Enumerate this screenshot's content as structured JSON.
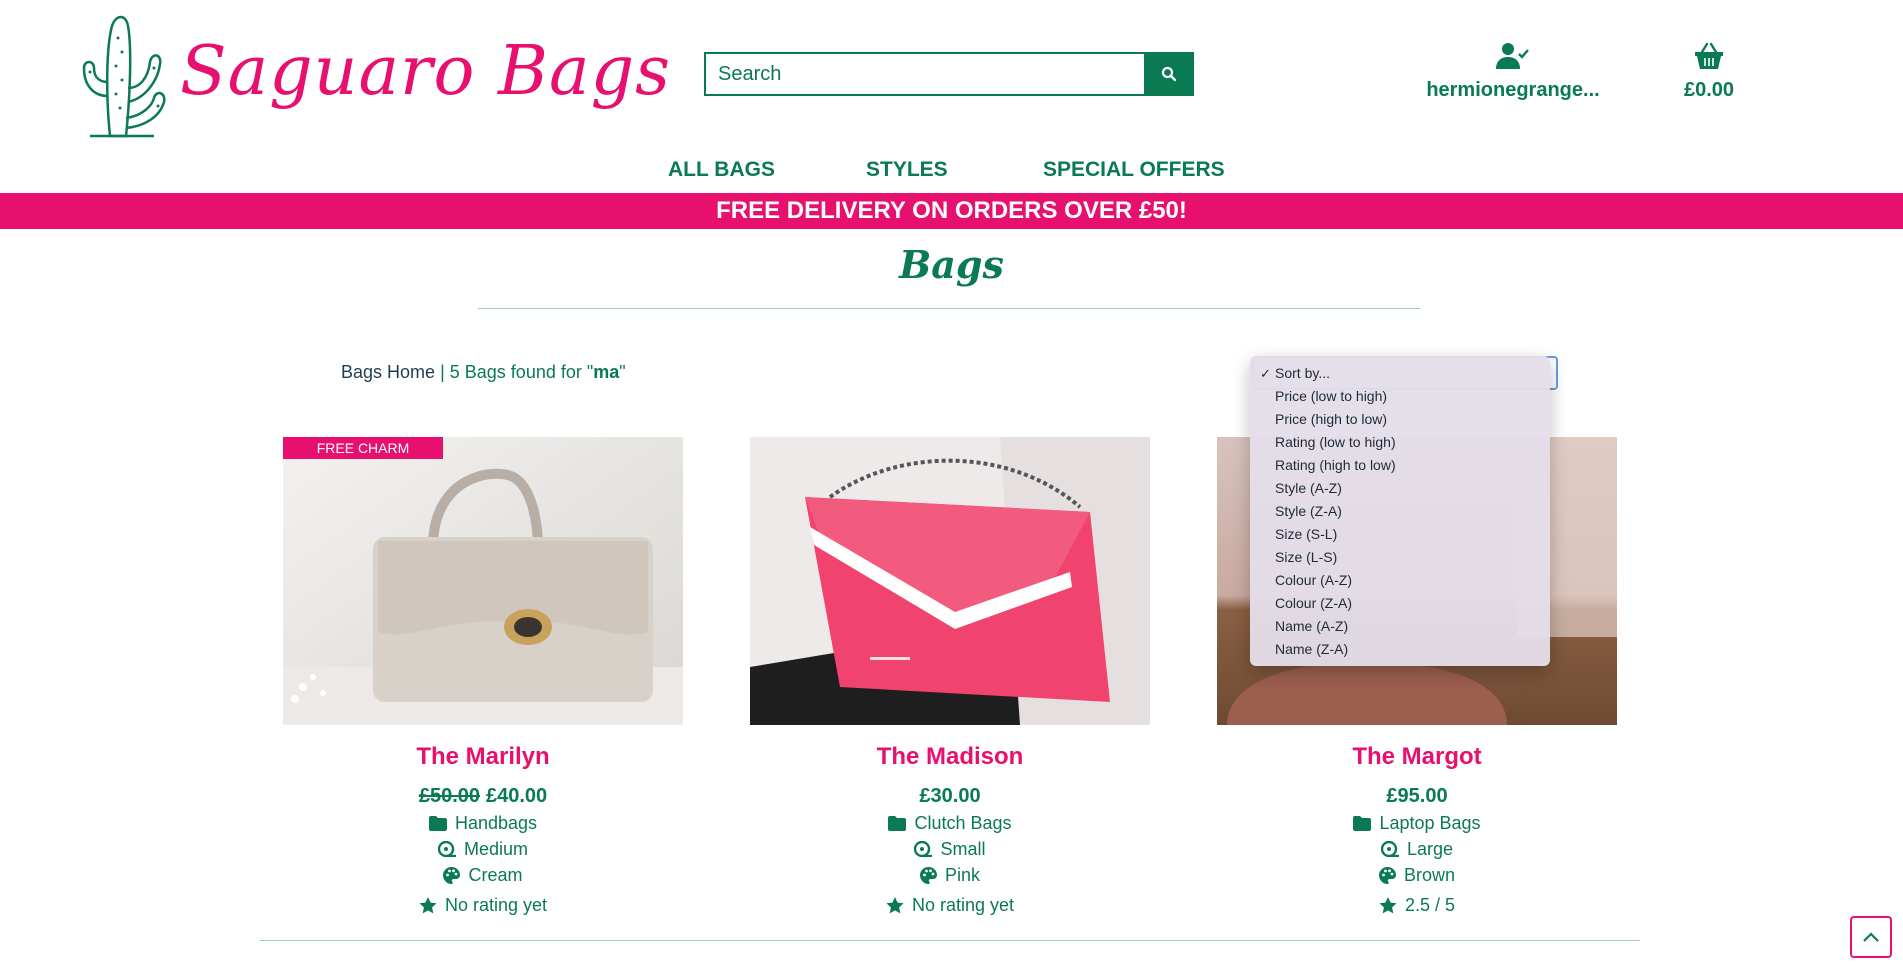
{
  "brand": {
    "name": "Saguaro Bags",
    "accent": "#e8106e",
    "primary": "#0a7a53"
  },
  "search": {
    "placeholder": "Search",
    "icon": "search-icon"
  },
  "account": {
    "username": "hermionegrange...",
    "icon": "user-check-icon"
  },
  "basket": {
    "total": "£0.00",
    "icon": "basket-icon"
  },
  "nav": {
    "items": [
      "ALL BAGS",
      "STYLES",
      "SPECIAL OFFERS"
    ]
  },
  "banner": {
    "text": "FREE DELIVERY ON ORDERS OVER £50!"
  },
  "page": {
    "title": "Bags"
  },
  "breadcrumb": {
    "home": "Bags Home",
    "separator": "|",
    "count_text": "5 Bags found for \"",
    "term": "ma",
    "close": "\""
  },
  "sort": {
    "selected": "Sort by...",
    "options": [
      "Sort by...",
      "Price (low to high)",
      "Price (high to low)",
      "Rating (low to high)",
      "Rating (high to low)",
      "Style (A-Z)",
      "Style (Z-A)",
      "Size (S-L)",
      "Size (L-S)",
      "Colour (A-Z)",
      "Colour (Z-A)",
      "Name (A-Z)",
      "Name (Z-A)"
    ]
  },
  "products": [
    {
      "badge": "FREE CHARM",
      "name": "The Marilyn",
      "old_price": "£50.00",
      "price": "£40.00",
      "style": "Handbags",
      "size": "Medium",
      "colour": "Cream",
      "rating": "No rating yet"
    },
    {
      "badge": "",
      "name": "The Madison",
      "old_price": "",
      "price": "£30.00",
      "style": "Clutch Bags",
      "size": "Small",
      "colour": "Pink",
      "rating": "No rating yet"
    },
    {
      "badge": "",
      "name": "The Margot",
      "old_price": "",
      "price": "£95.00",
      "style": "Laptop Bags",
      "size": "Large",
      "colour": "Brown",
      "rating": "2.5 / 5"
    }
  ]
}
